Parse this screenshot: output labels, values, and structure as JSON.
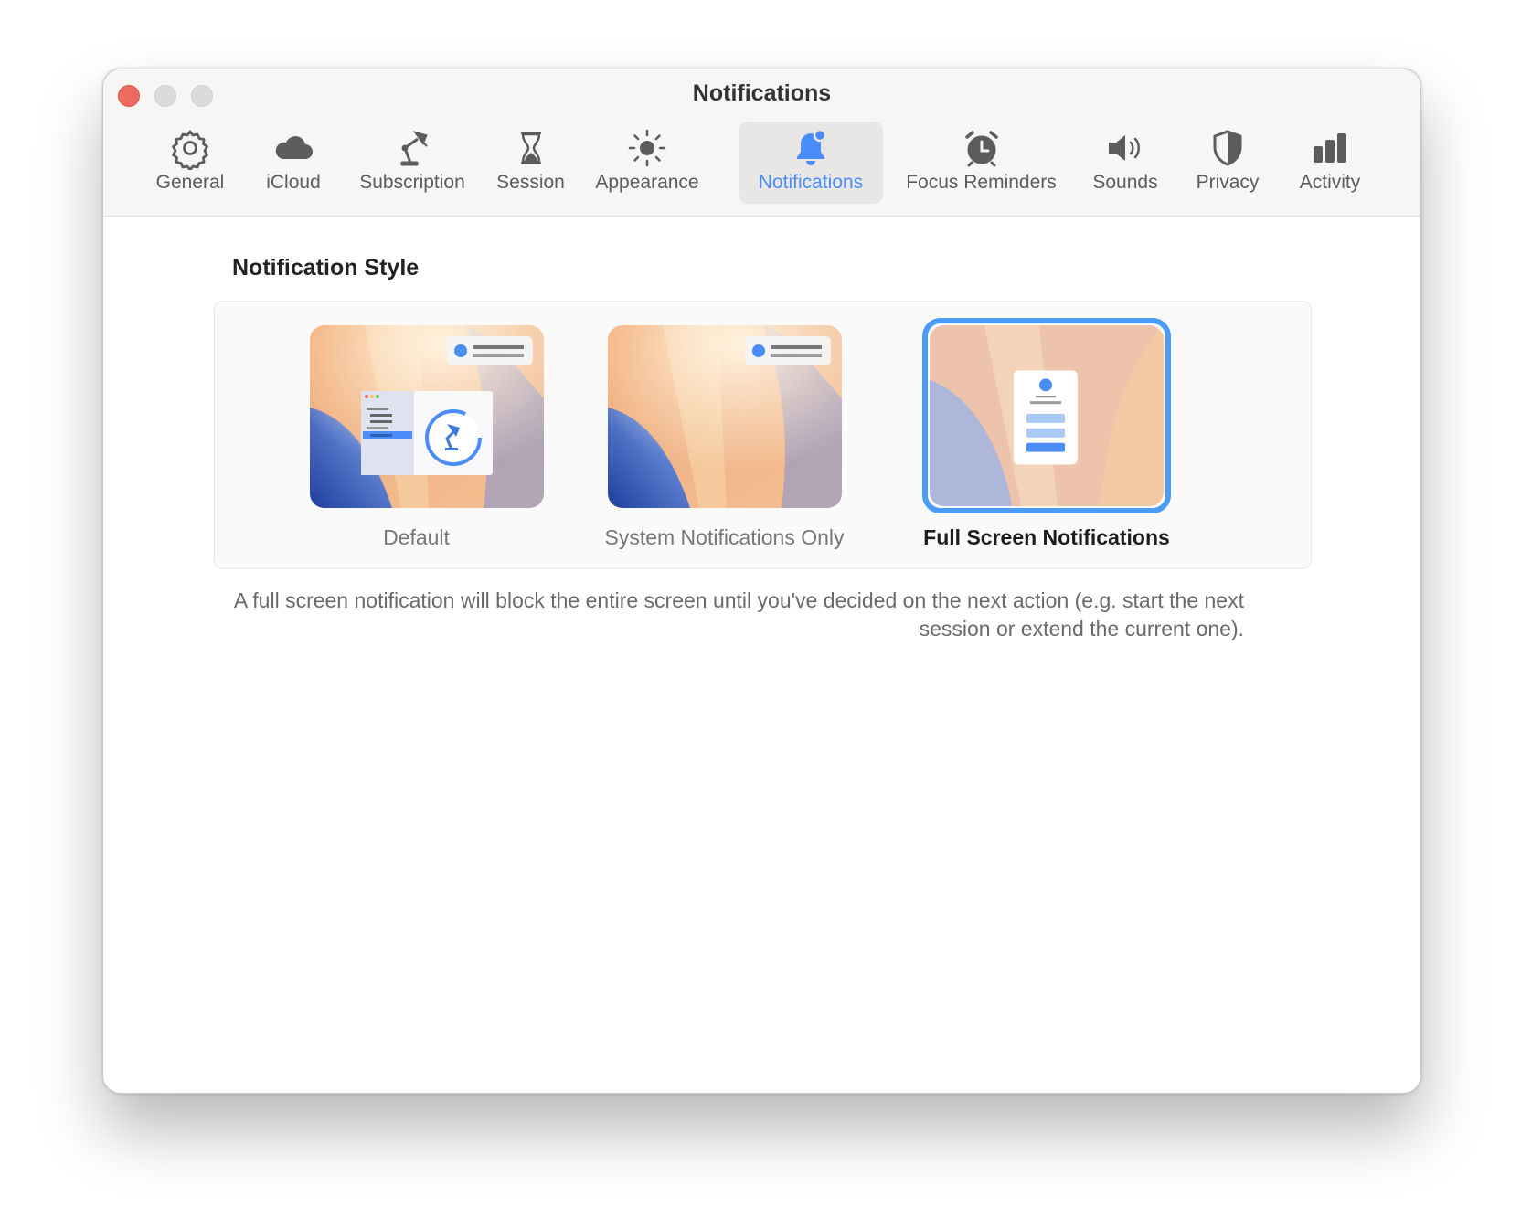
{
  "window": {
    "title": "Notifications"
  },
  "tabs": [
    {
      "id": "general",
      "label": "General",
      "icon": "gear-icon"
    },
    {
      "id": "icloud",
      "label": "iCloud",
      "icon": "cloud-icon"
    },
    {
      "id": "subscription",
      "label": "Subscription",
      "icon": "desk-lamp-icon"
    },
    {
      "id": "session",
      "label": "Session",
      "icon": "hourglass-icon"
    },
    {
      "id": "appearance",
      "label": "Appearance",
      "icon": "sun-icon"
    },
    {
      "id": "notifications",
      "label": "Notifications",
      "icon": "bell-badge-icon",
      "active": true
    },
    {
      "id": "focus-reminders",
      "label": "Focus Reminders",
      "icon": "alarm-clock-icon"
    },
    {
      "id": "sounds",
      "label": "Sounds",
      "icon": "speaker-icon"
    },
    {
      "id": "privacy",
      "label": "Privacy",
      "icon": "shield-icon"
    },
    {
      "id": "activity",
      "label": "Activity",
      "icon": "bar-chart-icon"
    }
  ],
  "notification_style": {
    "title": "Notification Style",
    "options": [
      {
        "id": "default",
        "label": "Default"
      },
      {
        "id": "system-only",
        "label": "System Notifications Only"
      },
      {
        "id": "full-screen",
        "label": "Full Screen Notifications",
        "selected": true
      }
    ],
    "description": "A full screen notification will block the entire screen until you've decided on the next action (e.g. start the next session or extend the current one)."
  },
  "colors": {
    "accent": "#4a8df8",
    "selection_ring": "#4c9cf5",
    "close": "#ed6a5e"
  }
}
